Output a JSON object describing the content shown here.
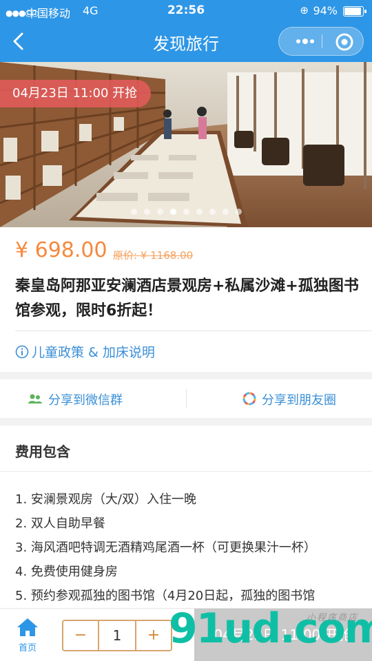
{
  "status_bar": {
    "carrier": "中国移动",
    "network": "4G",
    "time": "22:56",
    "battery": "94%",
    "battery_level": 0.94
  },
  "nav": {
    "title": "发现旅行",
    "icons": [
      "back-arrow-icon",
      "more-dots-icon",
      "target-icon"
    ]
  },
  "hero": {
    "badge": "04月23日 11:00 开抢",
    "slide_count": 9,
    "active_slide": 3
  },
  "product": {
    "price": "¥ 698.00",
    "original_price": "原价: ¥ 1168.00",
    "name": "秦皇岛阿那亚安澜酒店景观房+私属沙滩+孤独图书馆参观，限时6折起！",
    "policy_link": "儿童政策 & 加床说明"
  },
  "share": {
    "wechat_group": "分享到微信群",
    "moments": "分享到朋友圈"
  },
  "fees": {
    "heading": "费用包含",
    "items": [
      "1. 安澜景观房（大/双）入住一晚",
      "2. 双人自助早餐",
      "3. 海风酒吧特调无酒精鸡尾酒一杯（可更换果汁一杯）",
      "4. 免费使用健身房",
      "5. 预约参观孤独的图书馆（4月20日起，孤独的图书馆"
    ]
  },
  "bottom_bar": {
    "home_label": "首页",
    "minus": "−",
    "quantity": "1",
    "plus": "+",
    "buy_label": "04月23日 11:00 开抢"
  },
  "watermark": {
    "text": "91ud.com",
    "small_text": "小程序商店"
  },
  "colors": {
    "primary": "#2e96e6",
    "price": "#f5893c",
    "link": "#3a8fd6",
    "badge": "#e65c5c",
    "stepper_border": "#d6a56d",
    "disabled_button": "#c9c9c9"
  }
}
